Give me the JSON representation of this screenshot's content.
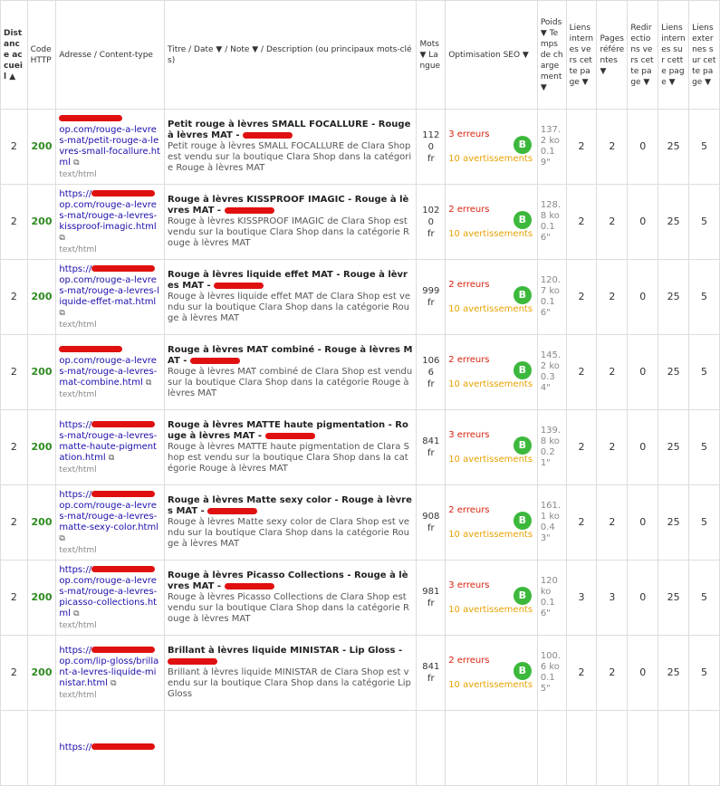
{
  "headers": {
    "distance": "Distance accueil ▲",
    "code": "Code HTTP",
    "address": "Adresse / Content-type",
    "title": "Titre / Date ▼ / Note ▼ / Description (ou principaux mots-clés)",
    "mots": "Mots ▼ Langue",
    "seo": "Optimisation SEO ▼",
    "poids": "Poids ▼ Temps de chargement ▼",
    "liens_vers": "Liens internes vers cette page ▼",
    "pages_ref": "Pages référentes ▼",
    "redir": "Redirections vers cette page ▼",
    "liens_int": "Liens internes sur cette page ▼",
    "liens_ext": "Liens externes sur cette page ▼"
  },
  "rows": [
    {
      "distance": "2",
      "code": "200",
      "url_prefix": "",
      "url": "op.com/rouge-a-levres-mat/petit-rouge-a-levres-small-focallure.html",
      "ctype": "text/html",
      "title": "Petit rouge à lèvres SMALL FOCALLURE - Rouge à lèvres MAT -",
      "desc": "Petit rouge à lèvres SMALL FOCALLURE de Clara Shop est vendu sur la boutique Clara Shop dans la catégorie Rouge à lèvres MAT",
      "mots": "1120",
      "lang": "fr",
      "errors": "3 erreurs",
      "warnings": "10 avertissements",
      "grade": "B",
      "poids": "137.2 ko",
      "time": "0.19\"",
      "liens_vers": "2",
      "pages_ref": "2",
      "redir": "0",
      "liens_int": "25",
      "liens_ext": "5"
    },
    {
      "distance": "2",
      "code": "200",
      "url_prefix": "https://",
      "url": "op.com/rouge-a-levres-mat/rouge-a-levres-kissproof-imagic.html",
      "ctype": "text/html",
      "title": "Rouge à lèvres KISSPROOF IMAGIC - Rouge à lèvres MAT -",
      "desc": "Rouge à lèvres KISSPROOF IMAGIC de Clara Shop est vendu sur la boutique Clara Shop dans la catégorie Rouge à lèvres MAT",
      "mots": "1020",
      "lang": "fr",
      "errors": "2 erreurs",
      "warnings": "10 avertissements",
      "grade": "B",
      "poids": "128.8 ko",
      "time": "0.16\"",
      "liens_vers": "2",
      "pages_ref": "2",
      "redir": "0",
      "liens_int": "25",
      "liens_ext": "5"
    },
    {
      "distance": "2",
      "code": "200",
      "url_prefix": "https://",
      "url": "op.com/rouge-a-levres-mat/rouge-a-levres-liquide-effet-mat.html",
      "ctype": "text/html",
      "title": "Rouge à lèvres liquide effet MAT - Rouge à lèvres MAT -",
      "desc": "Rouge à lèvres liquide effet MAT de Clara Shop est vendu sur la boutique Clara Shop dans la catégorie Rouge à lèvres MAT",
      "mots": "999",
      "lang": "fr",
      "errors": "2 erreurs",
      "warnings": "10 avertissements",
      "grade": "B",
      "poids": "120.7 ko",
      "time": "0.16\"",
      "liens_vers": "2",
      "pages_ref": "2",
      "redir": "0",
      "liens_int": "25",
      "liens_ext": "5"
    },
    {
      "distance": "2",
      "code": "200",
      "url_prefix": "",
      "url": "op.com/rouge-a-levres-mat/rouge-a-levres-mat-combine.html",
      "ctype": "text/html",
      "title": "Rouge à lèvres MAT combiné - Rouge à lèvres MAT -",
      "desc": "Rouge à lèvres MAT combiné de Clara Shop est vendu sur la boutique Clara Shop dans la catégorie Rouge à lèvres MAT",
      "mots": "1066",
      "lang": "fr",
      "errors": "2 erreurs",
      "warnings": "10 avertissements",
      "grade": "B",
      "poids": "145.2 ko",
      "time": "0.34\"",
      "liens_vers": "2",
      "pages_ref": "2",
      "redir": "0",
      "liens_int": "25",
      "liens_ext": "5"
    },
    {
      "distance": "2",
      "code": "200",
      "url_prefix": "https://",
      "url": "s-mat/rouge-a-levres-matte-haute-pigmentation.html",
      "ctype": "text/html",
      "title": "Rouge à lèvres MATTE haute pigmentation - Rouge à lèvres MAT -",
      "desc": "Rouge à lèvres MATTE haute pigmentation de Clara Shop est vendu sur la boutique Clara Shop dans la catégorie Rouge à lèvres MAT",
      "mots": "841",
      "lang": "fr",
      "errors": "3 erreurs",
      "warnings": "10 avertissements",
      "grade": "B",
      "poids": "139.8 ko",
      "time": "0.21\"",
      "liens_vers": "2",
      "pages_ref": "2",
      "redir": "0",
      "liens_int": "25",
      "liens_ext": "5"
    },
    {
      "distance": "2",
      "code": "200",
      "url_prefix": "https://",
      "url": "op.com/rouge-a-levres-mat/rouge-a-levres-matte-sexy-color.html",
      "ctype": "text/html",
      "title": "Rouge à lèvres Matte sexy color - Rouge à lèvres MAT -",
      "desc": "Rouge à lèvres Matte sexy color de Clara Shop est vendu sur la boutique Clara Shop dans la catégorie Rouge à lèvres MAT",
      "mots": "908",
      "lang": "fr",
      "errors": "2 erreurs",
      "warnings": "10 avertissements",
      "grade": "B",
      "poids": "161.1 ko",
      "time": "0.43\"",
      "liens_vers": "2",
      "pages_ref": "2",
      "redir": "0",
      "liens_int": "25",
      "liens_ext": "5"
    },
    {
      "distance": "2",
      "code": "200",
      "url_prefix": "https://",
      "url": "op.com/rouge-a-levres-mat/rouge-a-levres-picasso-collections.html",
      "ctype": "text/html",
      "title": "Rouge à lèvres Picasso Collections - Rouge à lèvres MAT -",
      "desc": "Rouge à lèvres Picasso Collections de Clara Shop est vendu sur la boutique Clara Shop dans la catégorie Rouge à lèvres MAT",
      "mots": "981",
      "lang": "fr",
      "errors": "3 erreurs",
      "warnings": "10 avertissements",
      "grade": "B",
      "poids": "120 ko",
      "time": "0.16\"",
      "liens_vers": "3",
      "pages_ref": "3",
      "redir": "0",
      "liens_int": "25",
      "liens_ext": "5"
    },
    {
      "distance": "2",
      "code": "200",
      "url_prefix": "https://",
      "url": "op.com/lip-gloss/brillant-a-levres-liquide-ministar.html",
      "ctype": "text/html",
      "title": "Brillant à lèvres liquide MINISTAR - Lip Gloss -",
      "desc": "Brillant à lèvres liquide MINISTAR de Clara Shop est vendu sur la boutique Clara Shop dans la catégorie Lip Gloss",
      "mots": "841",
      "lang": "fr",
      "errors": "2 erreurs",
      "warnings": "10 avertissements",
      "grade": "B",
      "poids": "100.6 ko",
      "time": "0.15\"",
      "liens_vers": "2",
      "pages_ref": "2",
      "redir": "0",
      "liens_int": "25",
      "liens_ext": "5"
    },
    {
      "distance": "",
      "code": "",
      "url_prefix": "https://",
      "url": "",
      "ctype": "",
      "title": "",
      "desc": "",
      "mots": "",
      "lang": "",
      "errors": "",
      "warnings": "",
      "grade": "",
      "poids": "",
      "time": "",
      "liens_vers": "",
      "pages_ref": "",
      "redir": "",
      "liens_int": "",
      "liens_ext": ""
    }
  ]
}
